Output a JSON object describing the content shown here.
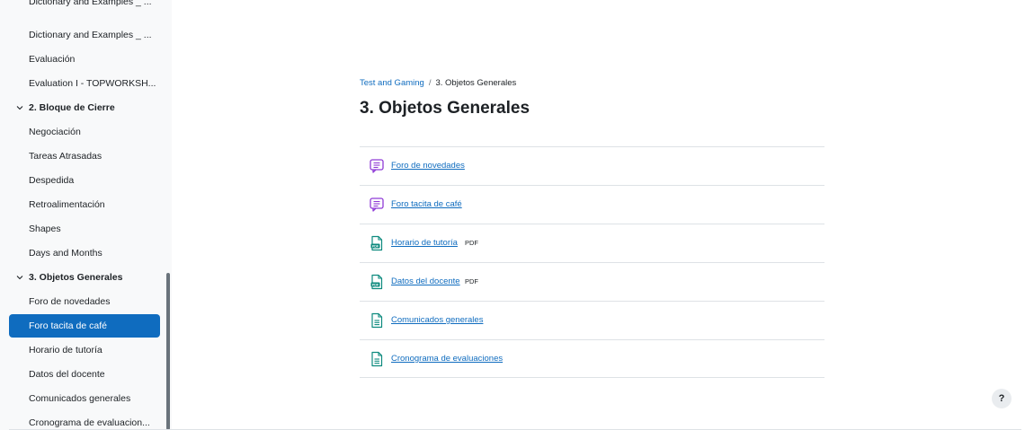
{
  "sidebar": {
    "items": [
      {
        "label": "Dictionary and Examples _ ...",
        "type": "item",
        "cut": true
      },
      {
        "label": "Dictionary and Examples _ ...",
        "type": "item"
      },
      {
        "label": "Evaluación",
        "type": "item"
      },
      {
        "label": "Evaluation I - TOPWORKSH...",
        "type": "item"
      },
      {
        "label": "2. Bloque de Cierre",
        "type": "section"
      },
      {
        "label": "Negociación",
        "type": "item"
      },
      {
        "label": "Tareas Atrasadas",
        "type": "item"
      },
      {
        "label": "Despedida",
        "type": "item"
      },
      {
        "label": "Retroalimentación",
        "type": "item"
      },
      {
        "label": "Shapes",
        "type": "item"
      },
      {
        "label": "Days and Months",
        "type": "item"
      },
      {
        "label": "3. Objetos Generales",
        "type": "section"
      },
      {
        "label": "Foro de novedades",
        "type": "item"
      },
      {
        "label": "Foro tacita de café",
        "type": "item",
        "active": true
      },
      {
        "label": "Horario de tutoría",
        "type": "item"
      },
      {
        "label": "Datos del docente",
        "type": "item"
      },
      {
        "label": "Comunicados generales",
        "type": "item"
      },
      {
        "label": "Cronograma de evaluacion...",
        "type": "item"
      }
    ]
  },
  "breadcrumb": {
    "course": "Test and Gaming",
    "separator": "/",
    "current": "3. Objetos Generales"
  },
  "page_title": "3. Objetos Generales",
  "activities": [
    {
      "name": "Foro de novedades",
      "icon": "forum-icon",
      "badge": ""
    },
    {
      "name": "Foro tacita de café",
      "icon": "forum-icon",
      "badge": ""
    },
    {
      "name": "Horario de tutoría",
      "icon": "pdf-file-icon",
      "badge": "PDF"
    },
    {
      "name": "Datos del docente",
      "icon": "pdf-file-icon",
      "badge": "PDF"
    },
    {
      "name": "Comunicados generales",
      "icon": "page-icon",
      "badge": ""
    },
    {
      "name": "Cronograma de evaluaciones",
      "icon": "page-icon",
      "badge": ""
    }
  ],
  "help": {
    "label": "?"
  },
  "colors": {
    "accent": "#0f6cbf",
    "forum_icon": "#8f3ad6",
    "file_icon": "#0d8a7e",
    "sidebar_bg": "#f8f9fa"
  }
}
